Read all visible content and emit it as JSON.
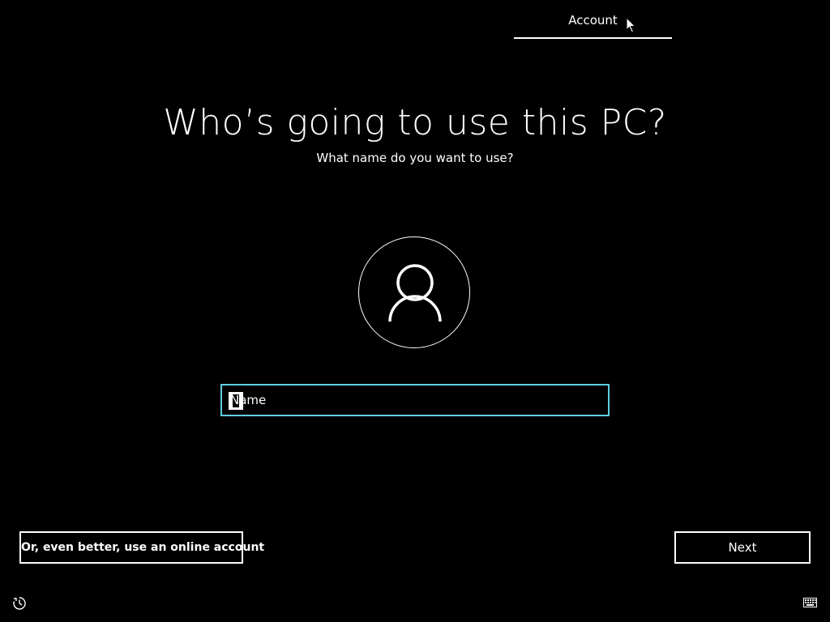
{
  "header": {
    "tab_label": "Account"
  },
  "main": {
    "title": "Who’s going to use this PC?",
    "subtitle": "What name do you want to use?",
    "avatar_icon": "user-icon",
    "name_field": {
      "placeholder": "Name",
      "value": ""
    }
  },
  "footer": {
    "online_account_label": "Or, even better, use an online account",
    "next_label": "Next",
    "ease_of_access_icon": "ease-of-access-icon",
    "keyboard_icon": "keyboard-icon"
  },
  "colors": {
    "background": "#000000",
    "text": "#ffffff",
    "focus_accent": "#5fcfe0"
  }
}
